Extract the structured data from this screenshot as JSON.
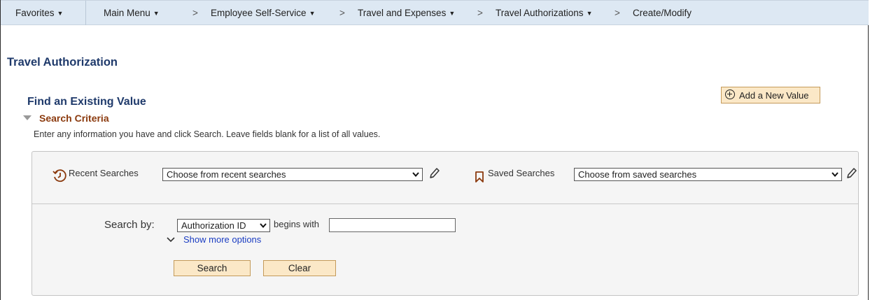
{
  "nav": {
    "favorites": "Favorites",
    "main_menu": "Main Menu",
    "separator": ">",
    "crumbs": [
      "Employee Self-Service",
      "Travel and Expenses",
      "Travel Authorizations"
    ],
    "current": "Create/Modify"
  },
  "page_title": "Travel Authorization",
  "find": {
    "title": "Find an Existing Value",
    "criteria_label": "Search Criteria",
    "instructions": "Enter any information you have and click Search. Leave fields blank for a list of all values."
  },
  "add_new_label": "Add a New Value",
  "recent": {
    "label": "Recent Searches",
    "selected": "Choose from recent searches"
  },
  "saved": {
    "label": "Saved Searches",
    "selected": "Choose from saved searches"
  },
  "search_by": {
    "label": "Search by:",
    "field": "Authorization ID",
    "operator": "begins with",
    "value": ""
  },
  "more_options": "Show more options",
  "buttons": {
    "search": "Search",
    "clear": "Clear"
  },
  "colors": {
    "nav_bg": "#dde8f3",
    "heading": "#1f3a6b",
    "criteria": "#8b3a0e",
    "button_bg": "#fbe8c7",
    "button_border": "#c49a5a",
    "link": "#1a3cc2"
  },
  "icons": {
    "recent": "history-clock-icon",
    "saved": "bookmark-icon",
    "edit": "pencil-icon",
    "add": "plus-circle-icon",
    "dropdown": "chevron-down-icon"
  }
}
